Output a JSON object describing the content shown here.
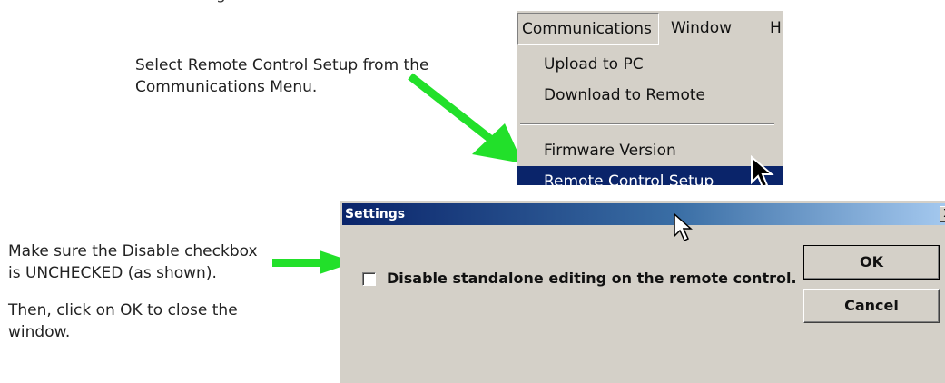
{
  "instructions": {
    "top_fragment": "g",
    "menu_step": "Select Remote Control Setup from the Communications Menu.",
    "checkbox_step": "Make sure the Disable checkbox is UNCHECKED (as shown).",
    "ok_step": "Then, click on OK to close the window."
  },
  "menubar": {
    "items": [
      {
        "label": "Communications"
      },
      {
        "label": "Window"
      },
      {
        "label": "H"
      }
    ]
  },
  "menu": {
    "items": [
      {
        "label": "Upload to PC"
      },
      {
        "label": "Download to Remote"
      },
      {
        "label": "Firmware Version"
      },
      {
        "label": "Remote Control Setup",
        "highlighted": true
      }
    ]
  },
  "dialog": {
    "title": "Settings",
    "close_glyph": "X",
    "checkbox_label": "Disable standalone editing on the remote control.",
    "checkbox_checked": false,
    "ok_label": "OK",
    "cancel_label": "Cancel"
  },
  "colors": {
    "arrow": "#22e02a",
    "menu_highlight": "#0a246a",
    "face": "#d4d0c8"
  }
}
